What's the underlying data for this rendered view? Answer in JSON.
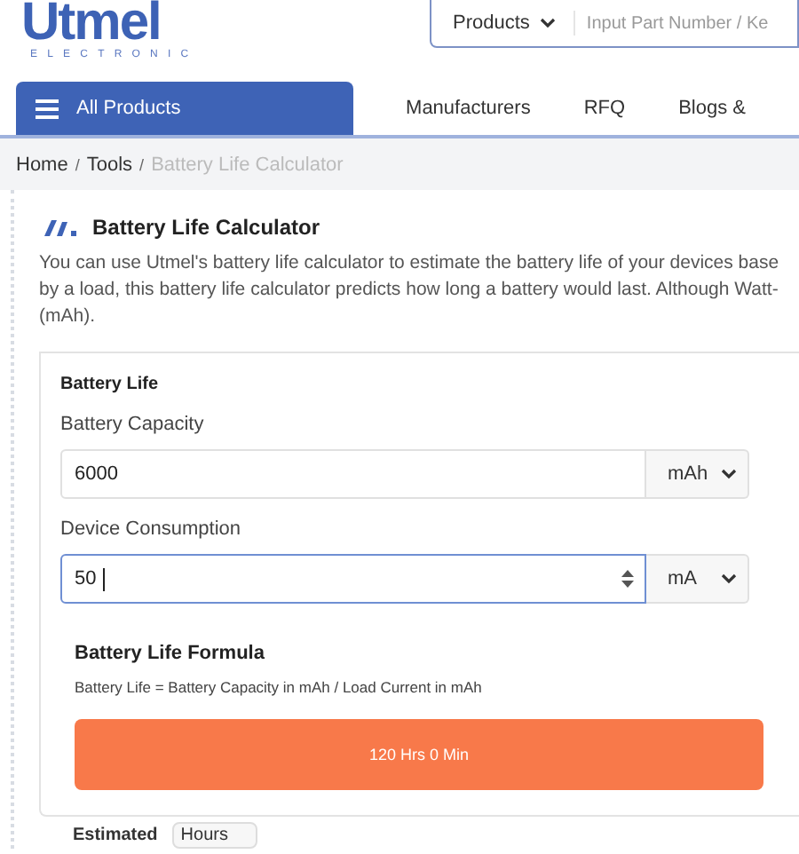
{
  "header": {
    "logo": "Utmel",
    "logo_subtitle": "ELECTRONIC",
    "search": {
      "category": "Products",
      "placeholder": "Input Part Number / Ke"
    }
  },
  "nav": {
    "menu_button": "All Products",
    "links": [
      "Manufacturers",
      "RFQ",
      "Blogs &"
    ]
  },
  "breadcrumb": {
    "separator": "/",
    "items": [
      {
        "label": "Home",
        "current": false
      },
      {
        "label": "Tools",
        "current": false
      },
      {
        "label": "Battery Life Calculator",
        "current": true
      }
    ]
  },
  "calculator": {
    "title": "Battery Life Calculator",
    "description_lines": [
      "You can use Utmel's battery life calculator to estimate the battery life of your devices base",
      "by a load, this battery life calculator predicts how long a battery would last. Although Watt-",
      "(mAh)."
    ],
    "section_title": "Battery Life",
    "fields": [
      {
        "label": "Battery Capacity",
        "value": "6000",
        "unit": "mAh",
        "focused": false
      },
      {
        "label": "Device Consumption",
        "value": "50",
        "unit": "mA",
        "focused": true
      }
    ],
    "formula": {
      "title": "Battery Life Formula",
      "text": "Battery Life = Battery Capacity in mAh / Load Current in mAh"
    },
    "result": "120 Hrs 0 Min",
    "estimate": {
      "label": "Estimated",
      "unit": "Hours"
    }
  }
}
